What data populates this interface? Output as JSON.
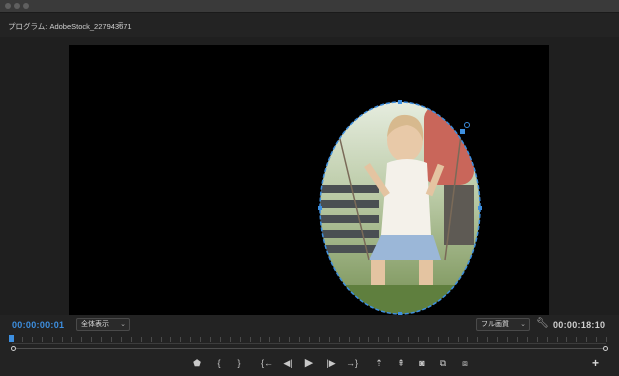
{
  "panel": {
    "title": "プログラム: AdobeStock_227943671",
    "menu_icon": "hamburger-icon"
  },
  "timecode": {
    "current": "00:00:00:01",
    "duration": "00:00:18:10"
  },
  "zoom": {
    "selected": "全体表示"
  },
  "resolution": {
    "selected": "フル画質"
  },
  "colors": {
    "accent": "#3d8fe0",
    "mask": "#3d8fe0",
    "background": "#232323",
    "frame": "#000000"
  },
  "playhead_position": 0.0,
  "transport": [
    {
      "name": "add-marker-button",
      "icon": "marker-icon",
      "glyph": "⬟"
    },
    {
      "name": "mark-in-button",
      "icon": "mark-in-icon",
      "glyph": "{"
    },
    {
      "name": "mark-out-button",
      "icon": "mark-out-icon",
      "glyph": "}"
    },
    {
      "name": "go-to-in-button",
      "icon": "go-to-in-icon",
      "glyph": "{←"
    },
    {
      "name": "step-back-button",
      "icon": "step-back-icon",
      "glyph": "◀|"
    },
    {
      "name": "play-button",
      "icon": "play-icon",
      "glyph": "▶"
    },
    {
      "name": "step-forward-button",
      "icon": "step-forward-icon",
      "glyph": "|▶"
    },
    {
      "name": "go-to-out-button",
      "icon": "go-to-out-icon",
      "glyph": "→}"
    },
    {
      "name": "lift-button",
      "icon": "lift-icon",
      "glyph": "⇡"
    },
    {
      "name": "extract-button",
      "icon": "extract-icon",
      "glyph": "⇞"
    },
    {
      "name": "export-frame-button",
      "icon": "camera-icon",
      "glyph": "◙"
    },
    {
      "name": "insert-button",
      "icon": "insert-icon",
      "glyph": "⧉"
    },
    {
      "name": "overwrite-button",
      "icon": "overwrite-icon",
      "glyph": "⧈"
    }
  ],
  "add_button": "+"
}
